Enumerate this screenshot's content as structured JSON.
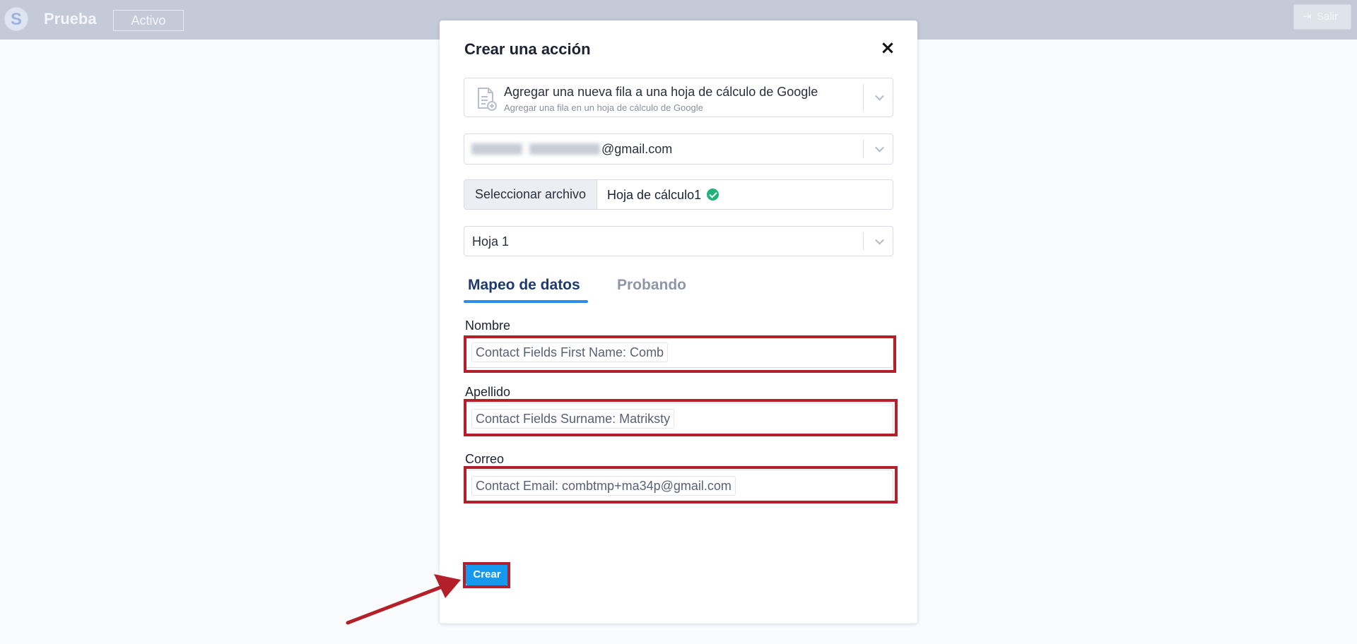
{
  "topbar": {
    "logo_letter": "S",
    "app_name": "Prueba",
    "status": "Activo",
    "logout": "Salir"
  },
  "modal": {
    "title": "Crear una acción",
    "action": {
      "main": "Agregar una nueva fila a una hoja de cálculo de Google",
      "sub": "Agregar una fila en un hoja de cálculo de Google",
      "icon": "spreadsheet-add-icon"
    },
    "account": {
      "email_suffix": "@gmail.com"
    },
    "file": {
      "button": "Seleccionar archivo",
      "name": "Hoja de cálculo1"
    },
    "sheet": {
      "value": "Hoja 1"
    },
    "tabs": [
      {
        "label": "Mapeo de datos",
        "active": true
      },
      {
        "label": "Probando",
        "active": false
      }
    ],
    "fields": [
      {
        "label": "Nombre",
        "value": "Contact Fields First Name: Comb"
      },
      {
        "label": "Apellido",
        "value": "Contact Fields Surname: Matriksty"
      },
      {
        "label": "Correo",
        "value": "Contact Email: combtmp+ma34p@gmail.com"
      }
    ],
    "create_button": "Crear"
  },
  "colors": {
    "accent": "#1599ee",
    "highlight": "#b3202a",
    "topbar": "#c5cad9",
    "check": "#1fb37a"
  }
}
